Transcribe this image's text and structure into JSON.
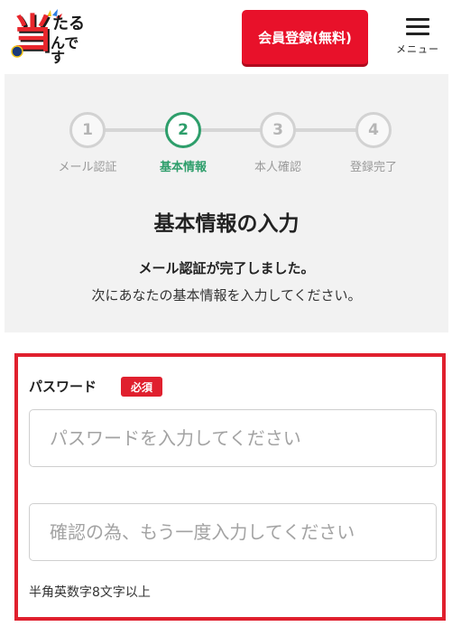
{
  "header": {
    "logo": {
      "main_char": "当",
      "line1": "たる",
      "line2": "んです"
    },
    "register_button": "会員登録(無料)",
    "menu_label": "メニュー",
    "accent_color": "#e8112a"
  },
  "steps": [
    {
      "number": "1",
      "label": "メール認証",
      "state": "done"
    },
    {
      "number": "2",
      "label": "基本情報",
      "state": "active"
    },
    {
      "number": "3",
      "label": "本人確認",
      "state": "pending"
    },
    {
      "number": "4",
      "label": "登録完了",
      "state": "pending"
    }
  ],
  "page": {
    "title": "基本情報の入力",
    "message_line1": "メール認証が完了しました。",
    "message_line2": "次にあなたの基本情報を入力してください。"
  },
  "form": {
    "password_label": "パスワード",
    "required_badge": "必須",
    "password_placeholder": "パスワードを入力してください",
    "password_value": "",
    "confirm_placeholder": "確認の為、もう一度入力してください",
    "confirm_value": "",
    "hint": "半角英数字8文字以上"
  },
  "colors": {
    "active_step": "#2e9e6b",
    "required": "#e0202e",
    "highlight_border": "#e0202e"
  }
}
